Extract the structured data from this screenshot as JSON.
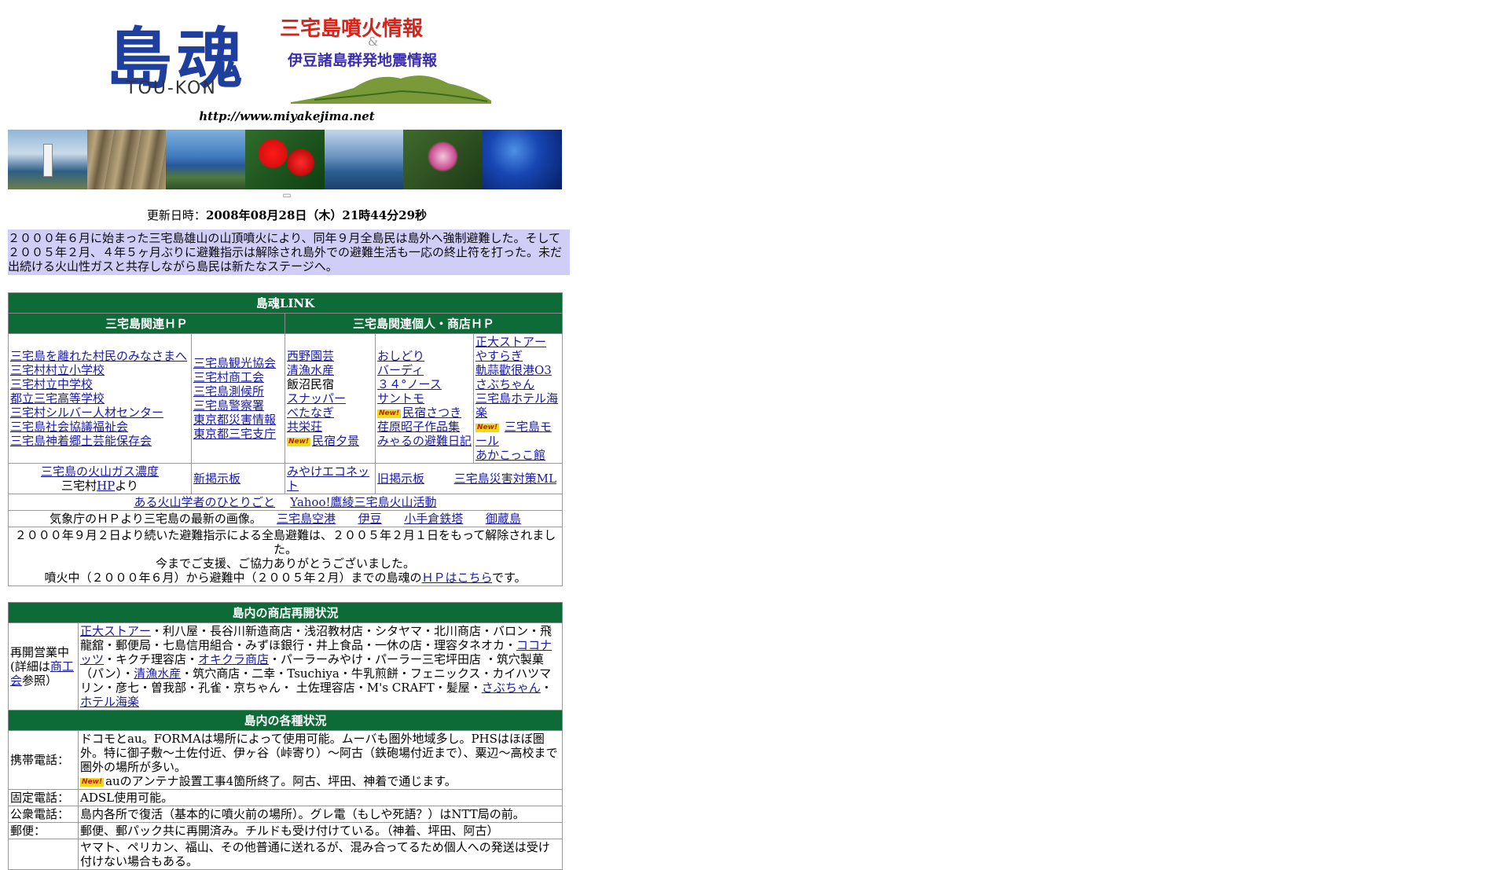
{
  "logo": {
    "main": "島魂",
    "sub": "TOU-KON",
    "right_line1": "三宅島噴火情報",
    "amp": "&",
    "right_line2": "伊豆諸島群発地震情報"
  },
  "site_url": "http://www.miyakejima.net",
  "photo_strip": [
    "lighthouse-photo",
    "fish-photo",
    "coast-photo",
    "hibiscus-photo",
    "island-photo",
    "lily-photo",
    "underwater-photo"
  ],
  "updated": {
    "label": "更新日時：",
    "value": "2008年08月28日（木）21時44分29秒"
  },
  "intro": "２０００年６月に始まった三宅島雄山の山頂噴火により、同年９月全島民は島外へ強制避難した。そして２００５年２月、４年５ヶ月ぶりに避難指示は解除され島外での避難生活も一応の終止符を打った。未だ出続ける火山性ガスと共存しながら島民は新たなステージへ。",
  "links": {
    "header": "島魂LINK",
    "col_head_left": "三宅島関連ＨＰ",
    "col_head_right": "三宅島関連個人・商店ＨＰ",
    "col1": [
      "三宅島を離れた村民のみなさまへ",
      "三宅村村立小学校",
      "三宅村立中学校",
      "都立三宅高等学校",
      "三宅村シルバー人材センター",
      "三宅島社会協議福祉会",
      "三宅島神着郷土芸能保存会"
    ],
    "col2": [
      "三宅島観光協会",
      "三宅村商工会",
      "三宅島測候所",
      "三宅島警察署",
      "東京都災害情報",
      "東京都三宅支庁"
    ],
    "col3": [
      {
        "text": "西野園芸",
        "link": true
      },
      {
        "text": "清漁水産",
        "link": true
      },
      {
        "text": "飯沼民宿",
        "link": false
      },
      {
        "text": "スナッパー",
        "link": true
      },
      {
        "text": "べたなぎ",
        "link": true
      },
      {
        "text": "共栄荘",
        "link": true
      },
      {
        "text": "民宿夕景",
        "link": true,
        "new": true
      }
    ],
    "col4": [
      {
        "text": "おしどり",
        "new": false
      },
      {
        "text": "バーディ",
        "new": false
      },
      {
        "text": "３４°ノース",
        "new": false
      },
      {
        "text": "サントモ",
        "new": false
      },
      {
        "text": "民宿さつき",
        "new": true
      },
      {
        "text": "荏原昭子作品集",
        "new": false
      },
      {
        "text": "みゃるの避難日記",
        "new": false
      }
    ],
    "col5": [
      {
        "text": "正大ストアー",
        "new": false
      },
      {
        "text": "やすらぎ",
        "new": false
      },
      {
        "text": "軌蒜歡很港O3",
        "new": false
      },
      {
        "text": "さぶちゃん",
        "new": false
      },
      {
        "text": "三宅島ホテル海楽",
        "new": false
      },
      {
        "text": "三宅島モール",
        "new": true
      },
      {
        "text": "あかこっこ館",
        "new": false
      }
    ],
    "gas_link": "三宅島の火山ガス濃度",
    "gas_prefix": "三宅村",
    "gas_hp": "HP",
    "gas_suffix": "より",
    "new_bbs": "新掲示板",
    "ecoenet": "みやけエコネット",
    "old_bbs": "旧掲示板",
    "disaster_ml": "三宅島災害対策ML",
    "volcano_scientist": "ある火山学者のひとりごと",
    "yahoo_volcano": "Yahoo!鷹綾三宅島火山活動",
    "jma_text": "気象庁のＨＰより三宅島の最新の画像。",
    "cam1": "三宅島空港",
    "cam2": "伊豆",
    "cam3": "小手倉鉄塔",
    "cam4": "御蔵島",
    "notice1": "２０００年９月２日より続いた避難指示による全島避難は、２００５年２月１日をもって解除されました。",
    "notice2": "今までご支援、ご協力ありがとうございました。",
    "notice3_pre": "噴火中（２０００年６月）から避難中（２００５年２月）までの島魂の",
    "notice3_link": "ＨＰはこちら",
    "notice3_post": "です。"
  },
  "shops": {
    "header": "島内の商店再開状況",
    "label_pre": "再開営業中(詳細は",
    "label_link": "商工会",
    "label_post": "参照）",
    "p1_link": "正大ストアー",
    "p1": "・利八屋・長谷川新造商店・浅沼教材店・シタヤマ・北川商店・バロン・飛龍舘・郵便局・七島信用組合・みずほ銀行・井上食品・一休の店・理容タネオカ・",
    "p2_link": "ココナッツ",
    "p2": "・キクチ理容店・",
    "p3_link": "オキクラ商店",
    "p3": "・パーラーみやけ・パーラー三宅坪田店 ・筑穴製菓（パン）・",
    "p4_link": "清漁水産",
    "p4": "・筑穴商店・二幸・Tsuchiya・牛乳煎餅・フェニックス・カイハツマリン・彦七・曽我部・孔雀・京ちゃん・ 土佐理容店・M's CRAFT・髪屋・",
    "p5_link": "さぶちゃん",
    "p5": "・",
    "p6_link": "ホテル海楽"
  },
  "status": {
    "header": "島内の各種状況",
    "rows": [
      {
        "label": "携帯電話：",
        "text": "ドコモとau。FORMAは場所によって使用可能。ムーバも圏外地域多し。PHSはほぼ圏外。特に御子敷～土佐付近、伊ヶ谷（峠寄り）～阿古（鉄砲場付近まで）、粟辺～高校まで圏外の場所が多い。",
        "new_text": "auのアンテナ設置工事4箇所終了。阿古、坪田、神着で通じます。"
      },
      {
        "label": "固定電話：",
        "text": "ADSL使用可能。"
      },
      {
        "label": "公衆電話：",
        "text": "島内各所で復活（基本的に噴火前の場所）。グレ電（もしや死語？）はNTT局の前。"
      },
      {
        "label": "郵便：",
        "text": "郵便、郵パック共に再開済み。チルドも受け付けている。（神着、坪田、阿古）"
      },
      {
        "label": "",
        "text": "ヤマト、ペリカン、福山、その他普通に送れるが、混み合ってるため個人への発送は受け付けない場合もある。"
      }
    ]
  },
  "new_badge": "New!"
}
